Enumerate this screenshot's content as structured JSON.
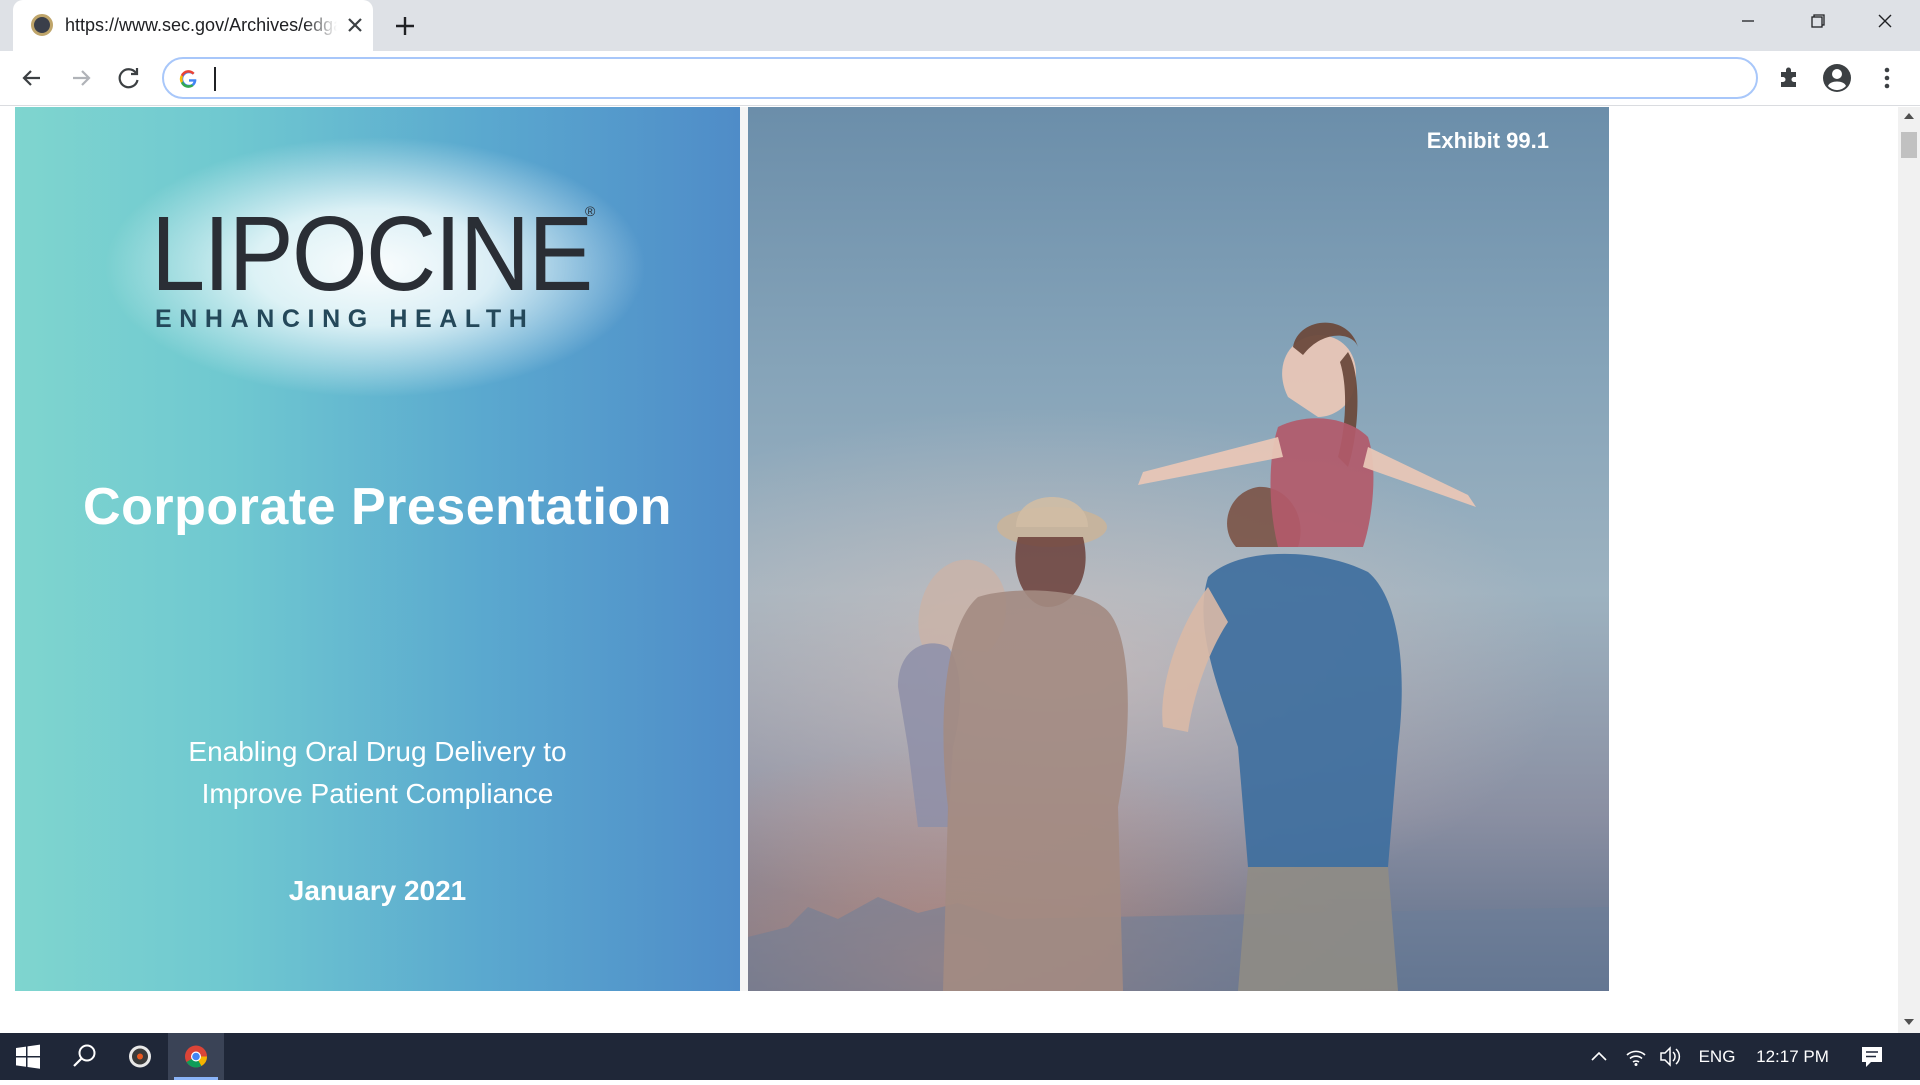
{
  "browser": {
    "tab": {
      "title": "https://www.sec.gov/Archives/edgar/data",
      "favicon": "sec-seal-icon"
    },
    "omnibox": {
      "value": "",
      "placeholder": ""
    },
    "icons": {
      "back": "arrow-left-icon",
      "forward": "arrow-right-icon",
      "reload": "reload-icon",
      "extensions": "puzzle-icon",
      "profile": "account-icon",
      "menu": "kebab-menu-icon"
    }
  },
  "slide": {
    "logo": {
      "word": "LIPOCINE",
      "registered": "®",
      "tagline": "ENHANCING HEALTH"
    },
    "title": "Corporate Presentation",
    "subtitle_line1": "Enabling Oral Drug Delivery to",
    "subtitle_line2": "Improve Patient Compliance",
    "date": "January 2021",
    "exhibit": "Exhibit 99.1"
  },
  "taskbar": {
    "language": "ENG",
    "time": "12:17 PM"
  },
  "colors": {
    "tabstrip": "#dee1e6",
    "omnibox_border": "#a8c7fa",
    "taskbar": "#1f2738",
    "slide_teal": "#7fd5cf",
    "slide_blue": "#4f8cc8"
  }
}
